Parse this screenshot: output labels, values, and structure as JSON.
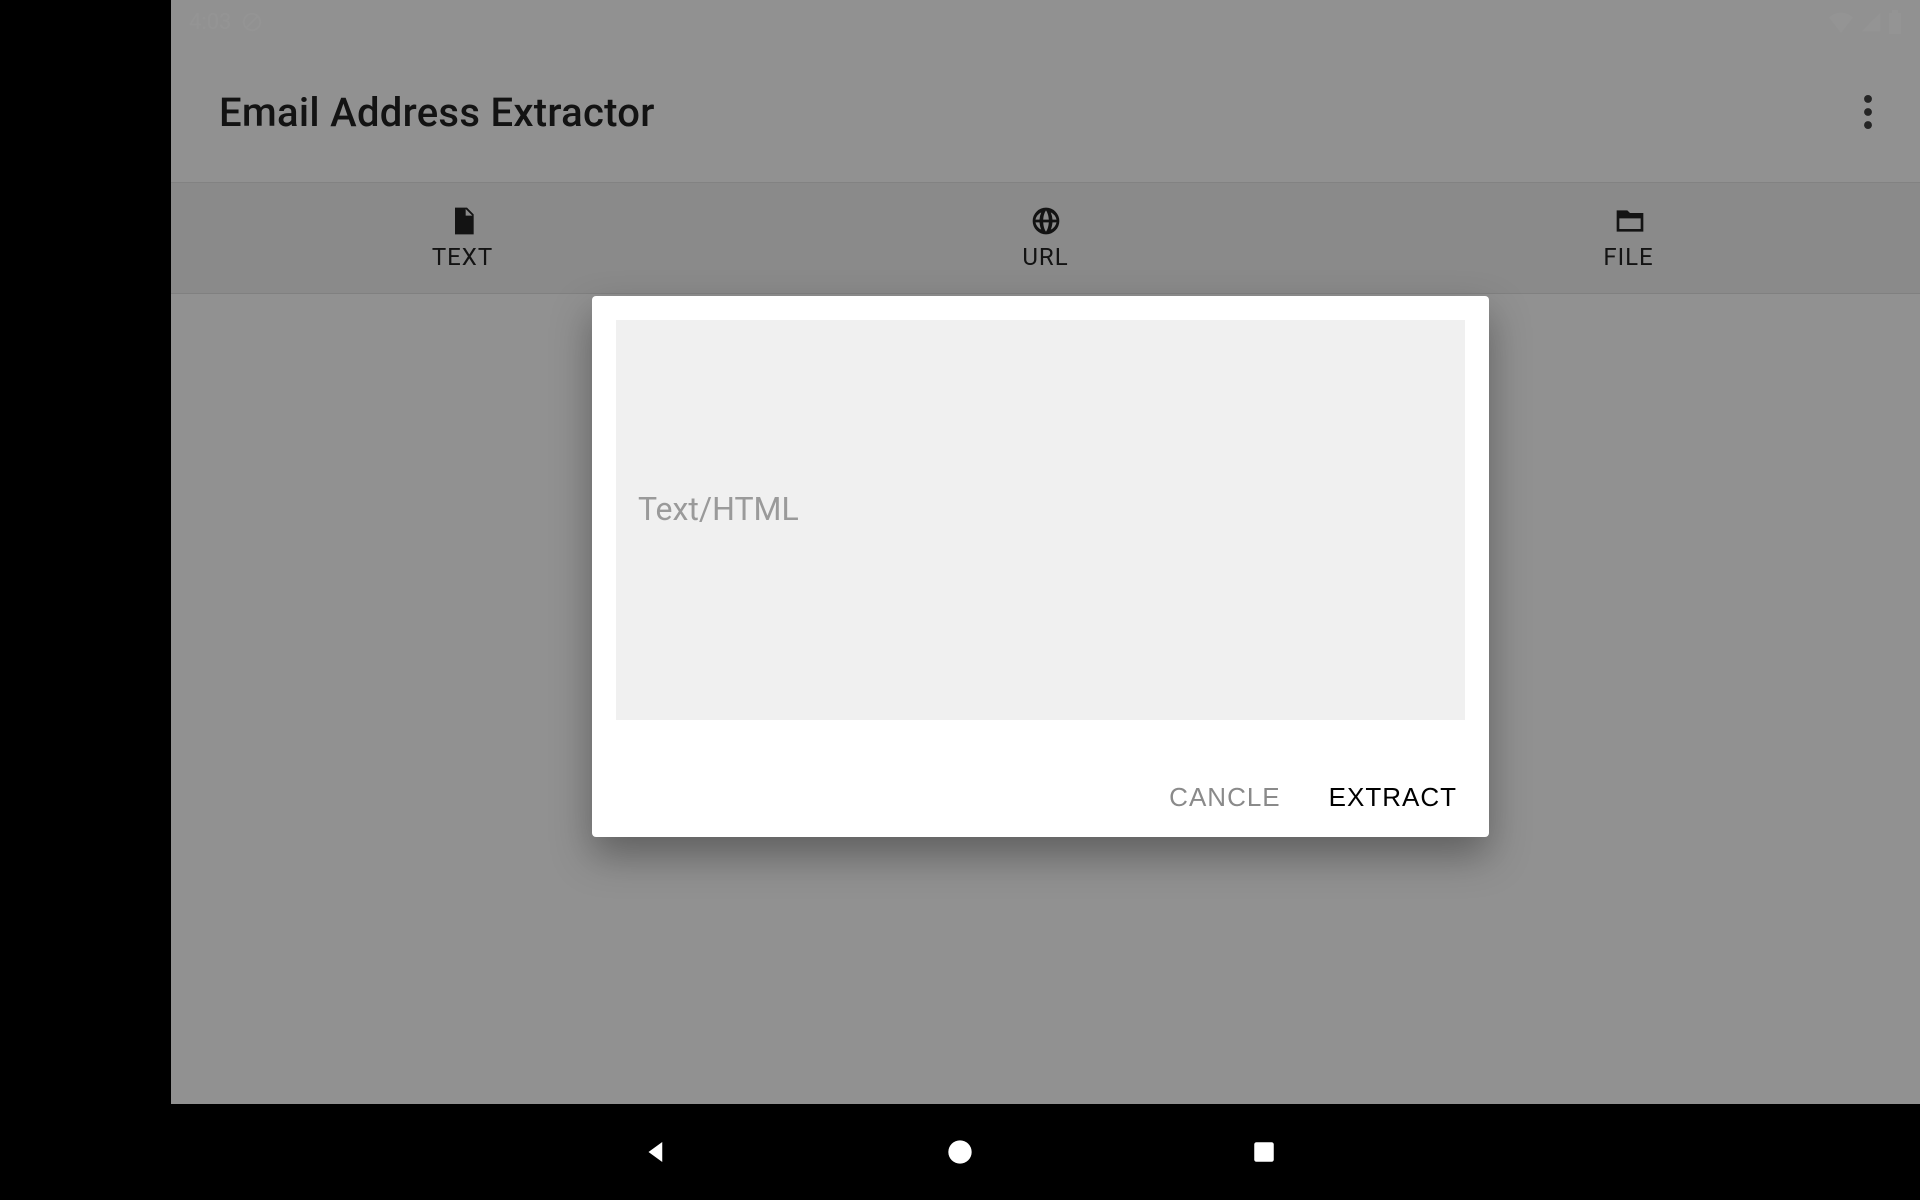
{
  "status": {
    "time": "4:03"
  },
  "app": {
    "title": "Email Address Extractor"
  },
  "tabs": {
    "text": "TEXT",
    "url": "URL",
    "file": "FILE"
  },
  "dialog": {
    "placeholder": "Text/HTML",
    "value": "",
    "cancel": "CANCLE",
    "extract": "EXTRACT"
  }
}
